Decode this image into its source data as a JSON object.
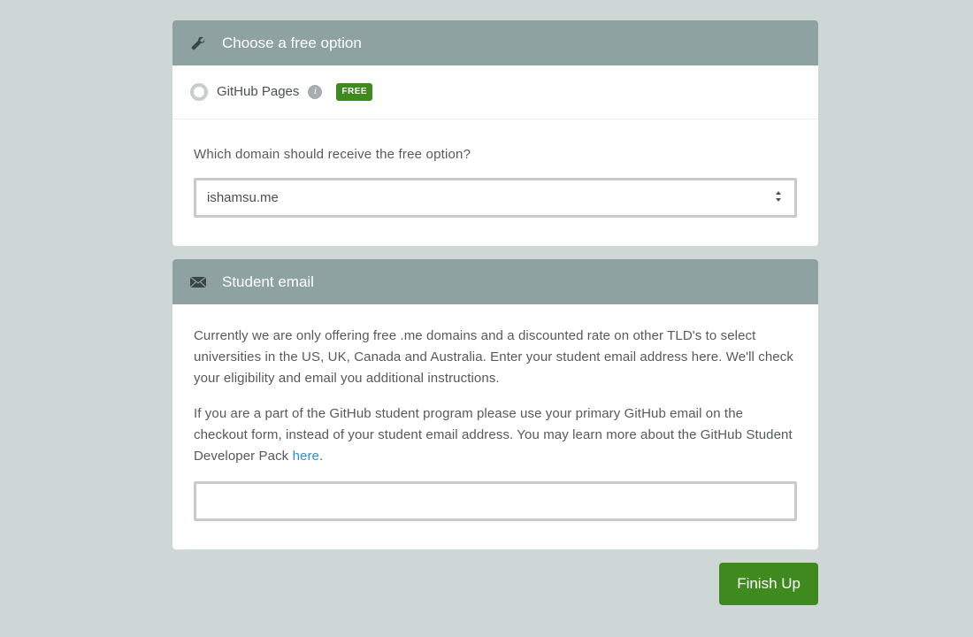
{
  "freeOptions": {
    "header": "Choose a free option",
    "option": {
      "label": "GitHub Pages",
      "badge": "FREE"
    },
    "domainQuestion": "Which domain should receive the free option?",
    "selectedDomain": "ishamsu.me"
  },
  "studentEmail": {
    "header": "Student email",
    "paragraph1": "Currently we are only offering free .me domains and a discounted rate on other TLD's to select universities in the US, UK, Canada and Australia. Enter your student email address here. We'll check your eligibility and email you additional instructions.",
    "paragraph2a": "If you are a part of the GitHub student program please use your primary GitHub email on the checkout form, instead of your student email address. You may learn more about the GitHub Student Developer Pack ",
    "linkText": "here",
    "paragraph2b": ".",
    "emailValue": ""
  },
  "finish": {
    "label": "Finish Up"
  }
}
